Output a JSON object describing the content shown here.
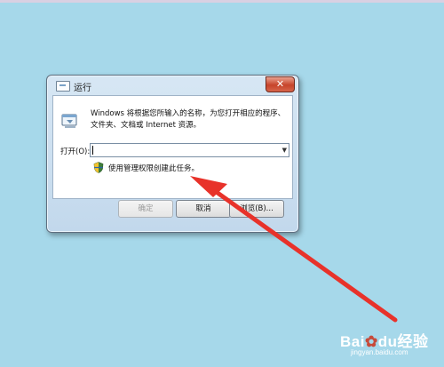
{
  "window": {
    "title": "运行",
    "close_label": "✕",
    "description": "Windows 将根据您所输入的名称，为您打开相应的程序、文件夹、文档或 Internet 资源。",
    "open_label": "打开(O):",
    "open_value": "",
    "admin_note": "使用管理权限创建此任务。",
    "buttons": {
      "ok": "确定",
      "cancel": "取消",
      "browse": "浏览(B)..."
    }
  },
  "watermark": {
    "brand": "Bai",
    "brand_paw": "du",
    "brand_cn": "经验",
    "url": "jingyan.baidu.com"
  },
  "colors": {
    "desktop": "#a6d8ea",
    "arrow": "#e8322a"
  }
}
